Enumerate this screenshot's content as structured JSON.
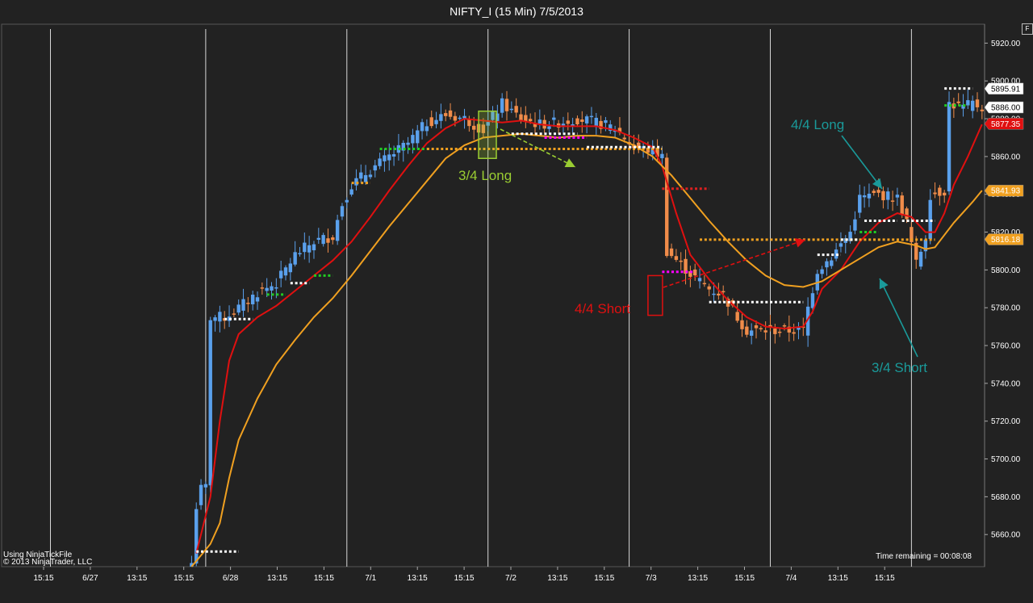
{
  "title": "NIFTY_I (15 Min)  7/5/2013",
  "corner_button": "F",
  "footer": {
    "source": "Using NinjaTickFile",
    "copyright": "© 2013 NinjaTrader, LLC",
    "time_remaining": "Time remaining = 00:08:08"
  },
  "colors": {
    "background": "#222222",
    "grid": "#d8d8d8",
    "up_candle": "#5aa0ec",
    "down_candle": "#f08c4a",
    "fast_ma": "#e01010",
    "slow_ma": "#f0a020",
    "dots_white": "#ffffff",
    "dots_orange": "#f0a020",
    "dots_green": "#22cc22",
    "dots_magenta": "#ff00ff",
    "dots_red": "#dd2020",
    "annotation_green": "#9acd32",
    "annotation_red": "#e01010",
    "annotation_teal": "#1a9a9a"
  },
  "chart_data": {
    "type": "candlestick",
    "instrument": "NIFTY_I",
    "interval": "15 Min",
    "date": "7/5/2013",
    "ylim": [
      5643,
      5930
    ],
    "y_ticks": [
      5660,
      5680,
      5700,
      5720,
      5740,
      5760,
      5780,
      5800,
      5820,
      5840,
      5860,
      5880,
      5900,
      5920
    ],
    "x_tick_labels": [
      "15:15",
      "6/27",
      "13:15",
      "15:15",
      "6/28",
      "13:15",
      "15:15",
      "7/1",
      "13:15",
      "15:15",
      "7/2",
      "13:15",
      "15:15",
      "7/3",
      "13:15",
      "15:15",
      "7/4",
      "13:15",
      "15:15"
    ],
    "bar_count": 199,
    "session_separators_bar_index": [
      0,
      33,
      63,
      93,
      123,
      153,
      183
    ],
    "price_markers": [
      {
        "label": "5895.91",
        "value": 5895.91,
        "style": "white"
      },
      {
        "label": "5886.00",
        "value": 5886.0,
        "style": "white"
      },
      {
        "label": "5877.35",
        "value": 5877.35,
        "style": "red"
      },
      {
        "label": "5841.93",
        "value": 5841.93,
        "style": "orange"
      },
      {
        "label": "5816.18",
        "value": 5816.18,
        "style": "orange"
      }
    ],
    "annotations": [
      {
        "text": "3/4 Long",
        "color": "green"
      },
      {
        "text": "4/4 Short",
        "color": "red"
      },
      {
        "text": "4/4 Long",
        "color": "teal"
      },
      {
        "text": "3/4 Short",
        "color": "teal"
      }
    ],
    "close_path": [
      [
        30,
        5645
      ],
      [
        31,
        5675
      ],
      [
        32,
        5684
      ],
      [
        33,
        5685
      ],
      [
        34,
        5775
      ],
      [
        37,
        5775
      ],
      [
        40,
        5780
      ],
      [
        44,
        5788
      ],
      [
        48,
        5793
      ],
      [
        52,
        5808
      ],
      [
        56,
        5815
      ],
      [
        60,
        5818
      ],
      [
        62,
        5835
      ],
      [
        64,
        5845
      ],
      [
        68,
        5853
      ],
      [
        72,
        5860
      ],
      [
        76,
        5867
      ],
      [
        80,
        5878
      ],
      [
        84,
        5882
      ],
      [
        88,
        5880
      ],
      [
        92,
        5874
      ],
      [
        96,
        5888
      ],
      [
        100,
        5880
      ],
      [
        104,
        5877
      ],
      [
        108,
        5878
      ],
      [
        112,
        5880
      ],
      [
        116,
        5878
      ],
      [
        120,
        5875
      ],
      [
        124,
        5865
      ],
      [
        128,
        5863
      ],
      [
        130,
        5860
      ],
      [
        131,
        5810
      ],
      [
        134,
        5803
      ],
      [
        136,
        5798
      ],
      [
        140,
        5790
      ],
      [
        143,
        5787
      ],
      [
        146,
        5775
      ],
      [
        148,
        5768
      ],
      [
        152,
        5768
      ],
      [
        156,
        5768
      ],
      [
        160,
        5768
      ],
      [
        161,
        5780
      ],
      [
        163,
        5800
      ],
      [
        166,
        5807
      ],
      [
        170,
        5820
      ],
      [
        172,
        5838
      ],
      [
        176,
        5840
      ],
      [
        180,
        5838
      ],
      [
        182,
        5825
      ],
      [
        184,
        5803
      ],
      [
        186,
        5818
      ],
      [
        187,
        5840
      ],
      [
        190,
        5842
      ],
      [
        191,
        5888
      ],
      [
        194,
        5886
      ],
      [
        196,
        5888
      ],
      [
        198,
        5886
      ]
    ],
    "series": [
      {
        "name": "fast_ma",
        "points": [
          [
            31,
            5650
          ],
          [
            34,
            5680
          ],
          [
            36,
            5720
          ],
          [
            38,
            5752
          ],
          [
            40,
            5766
          ],
          [
            44,
            5775
          ],
          [
            48,
            5781
          ],
          [
            52,
            5789
          ],
          [
            56,
            5797
          ],
          [
            60,
            5805
          ],
          [
            64,
            5815
          ],
          [
            68,
            5828
          ],
          [
            72,
            5842
          ],
          [
            76,
            5855
          ],
          [
            80,
            5867
          ],
          [
            84,
            5875
          ],
          [
            88,
            5880
          ],
          [
            92,
            5879
          ],
          [
            96,
            5878
          ],
          [
            100,
            5879
          ],
          [
            104,
            5877
          ],
          [
            108,
            5876
          ],
          [
            112,
            5876
          ],
          [
            116,
            5876
          ],
          [
            120,
            5874
          ],
          [
            124,
            5870
          ],
          [
            128,
            5865
          ],
          [
            130,
            5855
          ],
          [
            133,
            5830
          ],
          [
            136,
            5808
          ],
          [
            140,
            5795
          ],
          [
            144,
            5784
          ],
          [
            148,
            5775
          ],
          [
            152,
            5770
          ],
          [
            156,
            5769
          ],
          [
            160,
            5770
          ],
          [
            162,
            5778
          ],
          [
            164,
            5790
          ],
          [
            168,
            5800
          ],
          [
            172,
            5815
          ],
          [
            176,
            5825
          ],
          [
            180,
            5830
          ],
          [
            183,
            5828
          ],
          [
            186,
            5820
          ],
          [
            188,
            5820
          ],
          [
            190,
            5830
          ],
          [
            192,
            5845
          ],
          [
            195,
            5860
          ],
          [
            198,
            5877
          ]
        ]
      },
      {
        "name": "slow_ma",
        "points": [
          [
            30,
            5643
          ],
          [
            34,
            5655
          ],
          [
            36,
            5666
          ],
          [
            38,
            5690
          ],
          [
            40,
            5710
          ],
          [
            44,
            5732
          ],
          [
            48,
            5750
          ],
          [
            52,
            5763
          ],
          [
            56,
            5775
          ],
          [
            60,
            5785
          ],
          [
            64,
            5797
          ],
          [
            68,
            5810
          ],
          [
            72,
            5823
          ],
          [
            76,
            5835
          ],
          [
            80,
            5847
          ],
          [
            84,
            5859
          ],
          [
            88,
            5866
          ],
          [
            92,
            5870
          ],
          [
            96,
            5871
          ],
          [
            100,
            5872
          ],
          [
            104,
            5871
          ],
          [
            108,
            5870
          ],
          [
            112,
            5871
          ],
          [
            116,
            5871
          ],
          [
            120,
            5870
          ],
          [
            124,
            5866
          ],
          [
            128,
            5860
          ],
          [
            132,
            5850
          ],
          [
            136,
            5838
          ],
          [
            140,
            5826
          ],
          [
            144,
            5815
          ],
          [
            148,
            5805
          ],
          [
            152,
            5797
          ],
          [
            156,
            5792
          ],
          [
            160,
            5791
          ],
          [
            164,
            5794
          ],
          [
            168,
            5800
          ],
          [
            172,
            5806
          ],
          [
            176,
            5812
          ],
          [
            180,
            5815
          ],
          [
            184,
            5813
          ],
          [
            186,
            5811
          ],
          [
            188,
            5812
          ],
          [
            192,
            5825
          ],
          [
            196,
            5836
          ],
          [
            198,
            5842
          ]
        ]
      }
    ]
  }
}
